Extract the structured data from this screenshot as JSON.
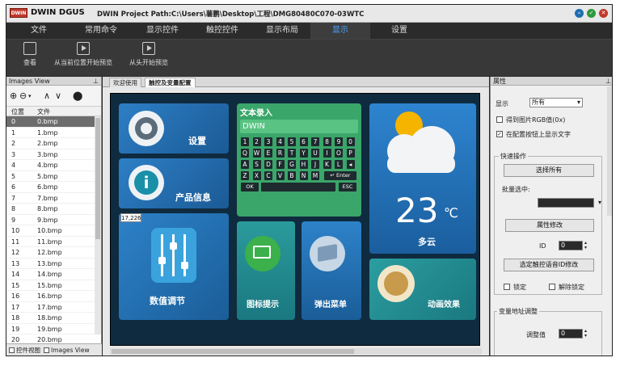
{
  "window": {
    "app_name": "DWIN DGUS",
    "logo_text": "DWIN",
    "project_path": "DWIN Project Path:C:\\Users\\薯鹏\\Desktop\\工程\\DMG80480C070-03WTC"
  },
  "menu": [
    "文件",
    "常用命令",
    "显示控件",
    "触控控件",
    "显示布局",
    "显示",
    "设置"
  ],
  "menu_active_index": 5,
  "toolbar": {
    "view": "查看",
    "preview_current": "从当前位置开始预览",
    "preview_start": "从头开始预览"
  },
  "left_panel": {
    "title": "Images View",
    "col_pos": "位置",
    "col_file": "文件",
    "rows": [
      {
        "pos": "0",
        "file": "0.bmp"
      },
      {
        "pos": "1",
        "file": "1.bmp"
      },
      {
        "pos": "2",
        "file": "2.bmp"
      },
      {
        "pos": "3",
        "file": "3.bmp"
      },
      {
        "pos": "4",
        "file": "4.bmp"
      },
      {
        "pos": "5",
        "file": "5.bmp"
      },
      {
        "pos": "6",
        "file": "6.bmp"
      },
      {
        "pos": "7",
        "file": "7.bmp"
      },
      {
        "pos": "8",
        "file": "8.bmp"
      },
      {
        "pos": "9",
        "file": "9.bmp"
      },
      {
        "pos": "10",
        "file": "10.bmp"
      },
      {
        "pos": "11",
        "file": "11.bmp"
      },
      {
        "pos": "12",
        "file": "12.bmp"
      },
      {
        "pos": "13",
        "file": "13.bmp"
      },
      {
        "pos": "14",
        "file": "14.bmp"
      },
      {
        "pos": "15",
        "file": "15.bmp"
      },
      {
        "pos": "16",
        "file": "16.bmp"
      },
      {
        "pos": "17",
        "file": "17.bmp"
      },
      {
        "pos": "18",
        "file": "18.bmp"
      },
      {
        "pos": "19",
        "file": "19.bmp"
      },
      {
        "pos": "20",
        "file": "20.bmp"
      }
    ],
    "bottom_tab_1": "控件视图",
    "bottom_tab_2": "Images View"
  },
  "center": {
    "tab_1": "欢迎使用",
    "tab_2": "触控及变量配置",
    "coords": "17,226",
    "tiles": {
      "settings": "设置",
      "product_info": "产品信息",
      "text_input_title": "文本录入",
      "text_input_value": "DWIN",
      "weather_temp": "23",
      "weather_unit": "℃",
      "weather_desc": "多云",
      "numeric_adjust": "数值调节",
      "icon_tips": "图标提示",
      "popup_menu": "弹出菜单",
      "animation": "动画效果"
    },
    "keyboard": {
      "row1": [
        "1",
        "2",
        "3",
        "4",
        "5",
        "6",
        "7",
        "8",
        "9",
        "0"
      ],
      "row2": [
        "Q",
        "W",
        "E",
        "R",
        "T",
        "Y",
        "U",
        "I",
        "O",
        "P"
      ],
      "row3": [
        "A",
        "S",
        "D",
        "F",
        "G",
        "H",
        "J",
        "K",
        "L",
        "◂"
      ],
      "row4": [
        "Z",
        "X",
        "C",
        "V",
        "B",
        "N",
        "M"
      ],
      "enter": "↵ Enter",
      "ok": "OK",
      "esc": "ESC"
    }
  },
  "right_panel": {
    "title": "属性",
    "display_label": "显示",
    "display_value": "所有",
    "get_rgb": "得到图片RGB值(0x)",
    "show_text": "在配置按钮上显示文字",
    "quick_ops": "快速操作",
    "select_all": "选择所有",
    "batch_selected": "批量选中:",
    "batch_value": "",
    "attr_modify": "属性修改",
    "id_label": "ID",
    "id_value": "0",
    "voice_id_modify": "选定触控语音ID修改",
    "lock": "锁定",
    "unlock": "解除锁定",
    "var_addr": "变量地址调整",
    "adjust_value_label": "调整值",
    "adjust_value": "0"
  },
  "colors": {
    "accent": "#4aa3ff",
    "canvas_bg": "#0f2b3f",
    "tile_blue": "#1f6fb0",
    "tile_teal": "#1a8f95",
    "keyboard_green": "#3aa66a"
  }
}
